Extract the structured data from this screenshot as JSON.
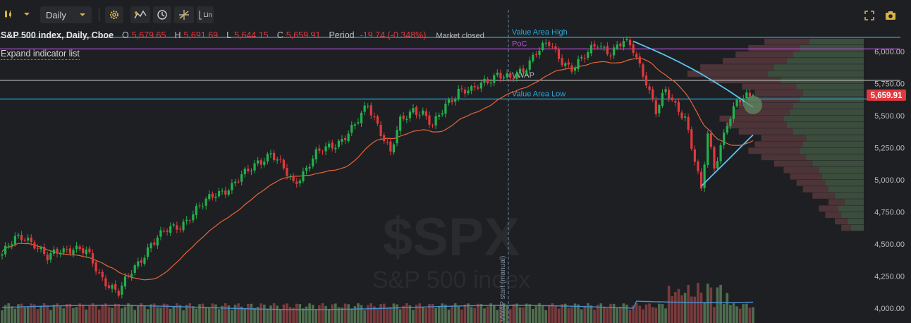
{
  "toolbar": {
    "interval": "Daily",
    "scale_label": "Lin"
  },
  "legend": {
    "symbol": "S&P 500 index, Daily, Cboe",
    "o_label": "O",
    "o_value": "5,679.65",
    "h_label": "H",
    "h_value": "5,691.69",
    "l_label": "L",
    "l_value": "5,644.15",
    "c_label": "C",
    "c_value": "5,659.91",
    "period_label": "Period",
    "period_value": "-19.74 (-0.348%)",
    "status": "Market closed"
  },
  "expand_indicators": "Expand indicator list",
  "watermark": {
    "ticker": "$SPX",
    "name": "S&P 500 index"
  },
  "colors": {
    "up": "#22b14c",
    "down": "#e0393e",
    "ma": "#e8643a",
    "vwap_band": "#59c3f0",
    "value_area": "#2aa7d9",
    "poc": "#b44fd6",
    "vwap_line": "#bdbdbd",
    "price_tag": "#e0393e",
    "background": "#1e1f22"
  },
  "chart_data": {
    "type": "candlestick",
    "title": "S&P 500 index, Daily, Cboe",
    "ylim": [
      3900,
      6200
    ],
    "y_ticks": [
      "6,000.00",
      "5,750.00",
      "5,500.00",
      "5,250.00",
      "5,000.00",
      "4,750.00",
      "4,500.00",
      "4,250.00",
      "4,000.00"
    ],
    "y_tick_values": [
      6000,
      5750,
      5500,
      5250,
      5000,
      4750,
      4500,
      4250,
      4000
    ],
    "last_price": 5659.91,
    "last_price_label": "5,659.91",
    "levels": [
      {
        "name": "Value Area High",
        "value": 6110
      },
      {
        "name": "PoC",
        "value": 6020
      },
      {
        "name": "VWAP",
        "value": 5775
      },
      {
        "name": "Value Area Low",
        "value": 5630
      }
    ],
    "vwap_start_label": "VWAP start (manual)",
    "anchors": [
      [
        0,
        4420
      ],
      [
        4,
        4530
      ],
      [
        7,
        4560
      ],
      [
        10,
        4510
      ],
      [
        14,
        4380
      ],
      [
        18,
        4450
      ],
      [
        22,
        4480
      ],
      [
        26,
        4430
      ],
      [
        30,
        4260
      ],
      [
        34,
        4170
      ],
      [
        36,
        4120
      ],
      [
        39,
        4240
      ],
      [
        42,
        4350
      ],
      [
        46,
        4510
      ],
      [
        51,
        4600
      ],
      [
        55,
        4650
      ],
      [
        58,
        4720
      ],
      [
        62,
        4800
      ],
      [
        66,
        4900
      ],
      [
        71,
        4950
      ],
      [
        75,
        5040
      ],
      [
        79,
        5150
      ],
      [
        83,
        5200
      ],
      [
        86,
        5110
      ],
      [
        90,
        4980
      ],
      [
        93,
        5060
      ],
      [
        97,
        5190
      ],
      [
        101,
        5260
      ],
      [
        105,
        5320
      ],
      [
        109,
        5410
      ],
      [
        113,
        5590
      ],
      [
        116,
        5440
      ],
      [
        120,
        5200
      ],
      [
        123,
        5450
      ],
      [
        127,
        5560
      ],
      [
        130,
        5520
      ],
      [
        133,
        5400
      ],
      [
        137,
        5590
      ],
      [
        141,
        5700
      ],
      [
        145,
        5680
      ],
      [
        149,
        5770
      ],
      [
        153,
        5830
      ],
      [
        157,
        5770
      ],
      [
        161,
        5860
      ],
      [
        165,
        6010
      ],
      [
        169,
        6050
      ],
      [
        172,
        5950
      ],
      [
        176,
        5880
      ],
      [
        180,
        5950
      ],
      [
        184,
        6060
      ],
      [
        188,
        6000
      ],
      [
        192,
        6070
      ],
      [
        195,
        6010
      ],
      [
        199,
        5780
      ],
      [
        202,
        5530
      ],
      [
        205,
        5680
      ],
      [
        208,
        5580
      ],
      [
        211,
        5500
      ],
      [
        214,
        5150
      ],
      [
        216,
        4900
      ],
      [
        218,
        5350
      ],
      [
        220,
        5100
      ],
      [
        222,
        5280
      ],
      [
        224,
        5450
      ],
      [
        227,
        5590
      ],
      [
        230,
        5640
      ],
      [
        232,
        5660
      ]
    ],
    "volume_profile": {
      "bins_from": 4600,
      "bins_to": 6100,
      "bin_size": 50,
      "up_volume": [
        20,
        25,
        35,
        40,
        30,
        45,
        55,
        60,
        65,
        70,
        80,
        90,
        100,
        95,
        90,
        110,
        120,
        125,
        115,
        110,
        100,
        95,
        105,
        130,
        150,
        140,
        120,
        110,
        100,
        85
      ],
      "down_volume": [
        15,
        20,
        25,
        30,
        25,
        35,
        40,
        45,
        50,
        55,
        60,
        70,
        80,
        75,
        70,
        85,
        95,
        100,
        90,
        85,
        80,
        75,
        85,
        110,
        125,
        115,
        100,
        90,
        80,
        70
      ]
    }
  }
}
